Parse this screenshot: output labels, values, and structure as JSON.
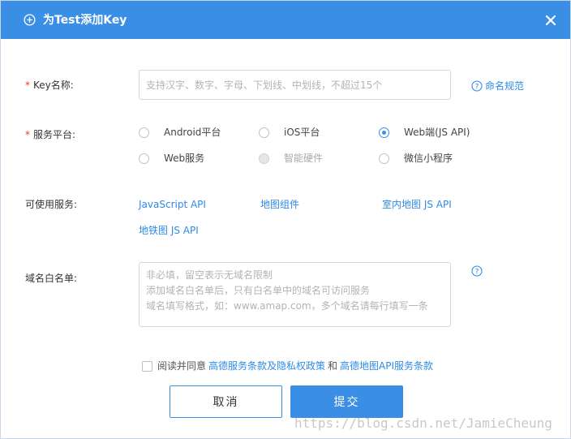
{
  "header": {
    "title": "为Test添加Key",
    "close_label": "×"
  },
  "key_name": {
    "required_mark": "*",
    "label": "Key名称:",
    "placeholder": "支持汉字、数字、字母、下划线、中划线，不超过15个",
    "value": "",
    "help_text": "命名规范"
  },
  "platform": {
    "required_mark": "*",
    "label": "服务平台:",
    "options": [
      {
        "label": "Android平台",
        "checked": false,
        "disabled": false
      },
      {
        "label": "iOS平台",
        "checked": false,
        "disabled": false
      },
      {
        "label": "Web端(JS API)",
        "checked": true,
        "disabled": false
      },
      {
        "label": "Web服务",
        "checked": false,
        "disabled": false
      },
      {
        "label": "智能硬件",
        "checked": false,
        "disabled": true
      },
      {
        "label": "微信小程序",
        "checked": false,
        "disabled": false
      }
    ]
  },
  "services": {
    "label": "可使用服务:",
    "items": [
      "JavaScript API",
      "地图组件",
      "室内地图 JS API",
      "地铁图 JS API"
    ]
  },
  "whitelist": {
    "label": "域名白名单:",
    "placeholder": "非必填，留空表示无域名限制\n添加域名白名单后，只有白名单中的域名可访问服务\n域名填写格式，如：www.amap.com，多个域名请每行填写一条",
    "value": ""
  },
  "agreement": {
    "checked": false,
    "prefix": "阅读并同意",
    "link1": "高德服务条款及隐私权政策",
    "and": "和",
    "link2": "高德地图API服务条款"
  },
  "buttons": {
    "cancel": "取消",
    "submit": "提交"
  },
  "watermark": "https://blog.csdn.net/JamieCheung",
  "colors": {
    "primary": "#3b8ee6",
    "link": "#2e8ae6",
    "required": "#e33333"
  },
  "icons": {
    "header": "plus-circle-icon",
    "close": "close-icon",
    "help": "question-circle-icon"
  }
}
